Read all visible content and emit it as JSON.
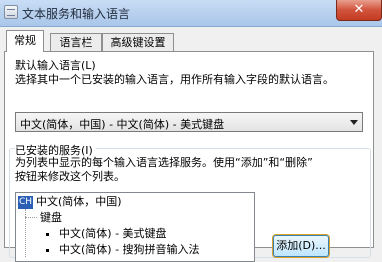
{
  "window": {
    "title": "文本服务和输入语言",
    "close_label": "✕"
  },
  "tabs": [
    {
      "label": "常规"
    },
    {
      "label": "语言栏"
    },
    {
      "label": "高级键设置"
    }
  ],
  "default_language": {
    "group_title": "默认输入语言(L)",
    "description": "选择其中一个已安装的输入语言，用作所有输入字段的默认语言。",
    "selected": "中文(简体，中国) - 中文(简体) - 美式键盘"
  },
  "installed_services": {
    "group_title": "已安装的服务(I)",
    "description_line1": "为列表中显示的每个输入语言选择服务。使用“添加”和“删除”",
    "description_line2": "按钮来修改这个列表。",
    "language_icon": "CH",
    "language": "中文(简体，中国)",
    "category": "键盘",
    "services": [
      "中文(简体) - 美式键盘",
      "中文(简体) - 搜狗拼音输入法"
    ],
    "add_button": "添加(D)..."
  }
}
